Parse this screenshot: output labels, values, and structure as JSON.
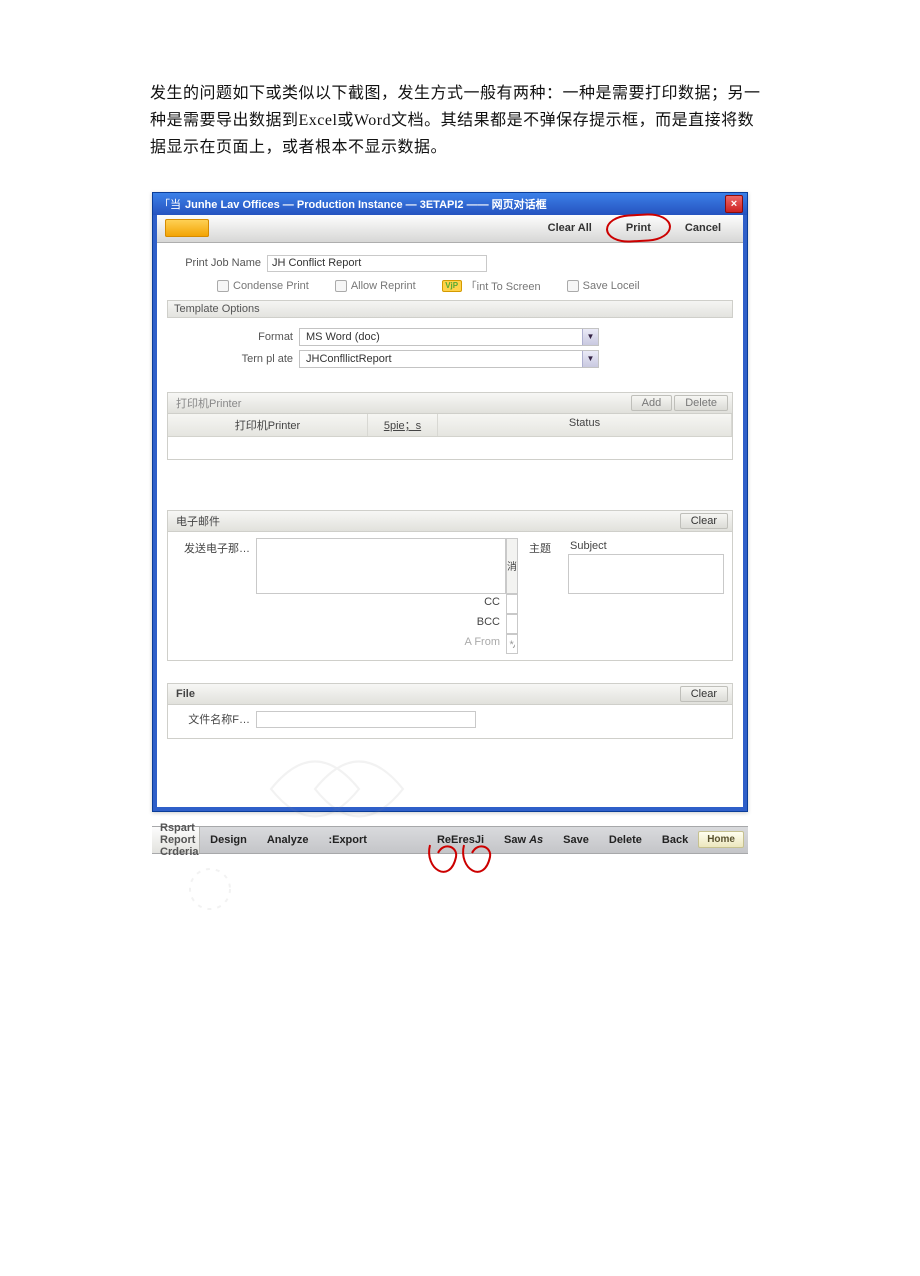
{
  "intro_text": "发生的问题如下或类似以下截图，发生方式一般有两种：一种是需要打印数据；另一种是需要导出数据到Excel或Word文档。其结果都是不弹保存提示框，而是直接将数据显示在页面上，或者根本不显示数据。",
  "dialog": {
    "title_prefix": "「当",
    "title": "Junhe Lav Offices — Production Instance — 3ETAPI2 —— 网页对话框",
    "close_glyph": "×",
    "toolbar": {
      "clear_all": "Clear All",
      "print": "Print",
      "cancel": "Cancel"
    },
    "job": {
      "label": "Print Job Name",
      "value": "JH Conflict Report",
      "checks": {
        "condense": "Condense Print",
        "allow_reprint": "Allow Reprint",
        "to_screen": "「int To Screen",
        "to_screen_tag": "VjP",
        "save_local": "Save Loceil"
      }
    },
    "tpl": {
      "header": "Template Options",
      "format_label": "Format",
      "format_value": "MS Word (doc)",
      "template_label": "Tern pl ate",
      "template_value": "JHConfllictReport"
    },
    "printer": {
      "header": "打印机Printer",
      "add": "Add",
      "delete": "Delete",
      "col1": "打印机Printer",
      "col2": "5pie",
      "col2_suffix": "；s",
      "col3": "Status"
    },
    "email": {
      "header": "电子邮件",
      "clear": "Clear",
      "send_to": "发送电子那…",
      "subject_cn": "主题",
      "subject_en": "Subject",
      "cancel": "消",
      "cc": "CC",
      "bcc": "BCC",
      "from": "A From",
      "from_value": "*Aiuj@junhe.口 oe"
    },
    "file": {
      "header": "File",
      "clear": "Clear",
      "name_label": "文件名称F…"
    }
  },
  "footer": {
    "left": "Rspart Report Crderia",
    "design": "Design",
    "analyze": "Analyze",
    "export": ":Export",
    "refresh": "ReEresJi",
    "save_as": "Saw",
    "save_as_em": "As",
    "save": "Save",
    "delete": "Delete",
    "back": "Back",
    "home": "Home"
  }
}
